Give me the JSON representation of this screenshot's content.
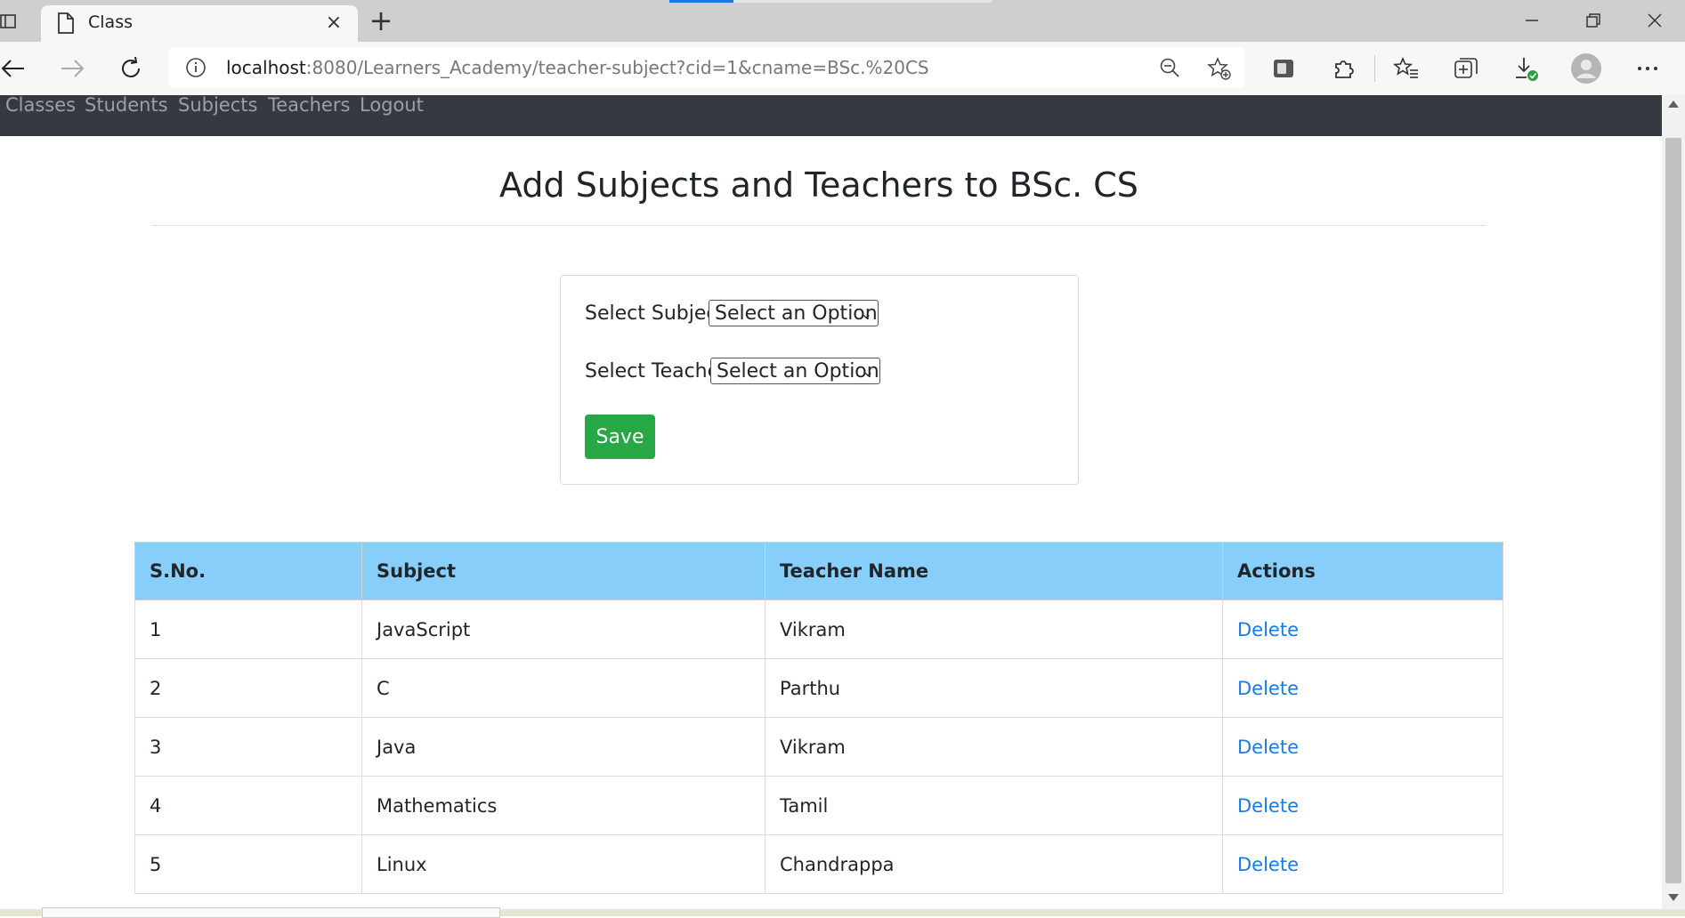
{
  "browser": {
    "tab_title": "Class",
    "url_host": "localhost",
    "url_rest": ":8080/Learners_Academy/teacher-subject?cid=1&cname=BSc.%20CS"
  },
  "nav": {
    "items": [
      "Classes",
      "Students",
      "Subjects",
      "Teachers",
      "Logout"
    ]
  },
  "page": {
    "title": "Add Subjects and Teachers to BSc. CS"
  },
  "form": {
    "subject_label": "Select Subject",
    "subject_value": "Select an Option",
    "teacher_label": "Select Teacher",
    "teacher_value": "Select an Option",
    "save_label": "Save"
  },
  "table": {
    "headers": [
      "S.No.",
      "Subject",
      "Teacher Name",
      "Actions"
    ],
    "rows": [
      {
        "sno": "1",
        "subject": "JavaScript",
        "teacher": "Vikram",
        "action": "Delete"
      },
      {
        "sno": "2",
        "subject": "C",
        "teacher": "Parthu",
        "action": "Delete"
      },
      {
        "sno": "3",
        "subject": "Java",
        "teacher": "Vikram",
        "action": "Delete"
      },
      {
        "sno": "4",
        "subject": "Mathematics",
        "teacher": "Tamil",
        "action": "Delete"
      },
      {
        "sno": "5",
        "subject": "Linux",
        "teacher": "Chandrappa",
        "action": "Delete"
      }
    ]
  },
  "colors": {
    "navbar": "#343a40",
    "table_header": "#87cefa",
    "save_button": "#28a745",
    "link": "#1f7ae0"
  }
}
